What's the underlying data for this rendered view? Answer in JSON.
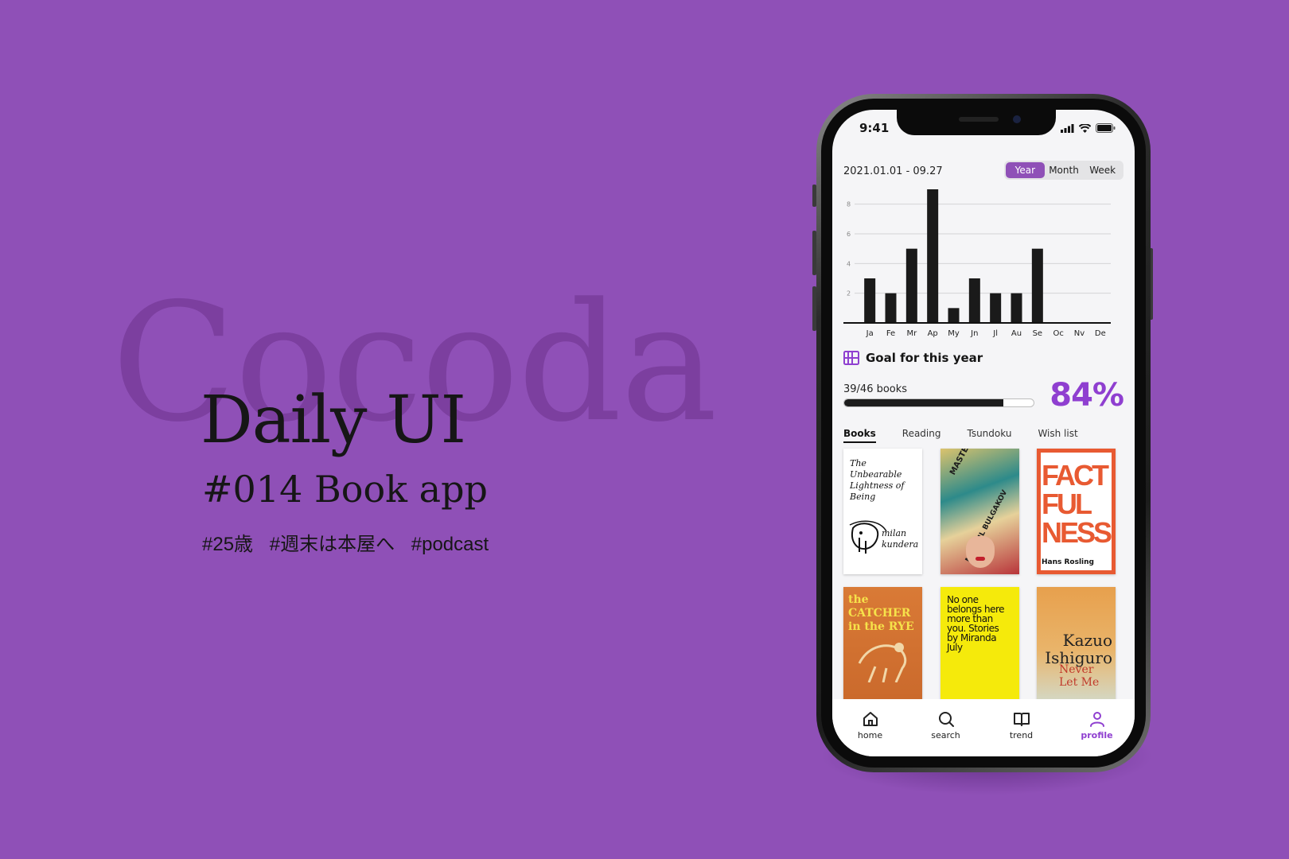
{
  "hero": {
    "watermark": "Cocoda",
    "title": "Daily UI",
    "subtitle": "#014 Book app",
    "tags": [
      "#25歳",
      "#週末は本屋へ",
      "#podcast"
    ]
  },
  "colors": {
    "background": "#8f50b7",
    "accent": "#8f3fd0"
  },
  "phone": {
    "status_time": "9:41",
    "status_icons": [
      "signal-icon",
      "wifi-icon",
      "battery-icon"
    ],
    "date_range": "2021.01.01 - 09.27",
    "period_options": [
      "Year",
      "Month",
      "Week"
    ],
    "period_selected": "Year",
    "goal": {
      "title": "Goal for this year",
      "count_label": "39/46 books",
      "percent_label": "84%",
      "progress": 0.84
    },
    "tabs": [
      "Books",
      "Reading",
      "Tsundoku",
      "Wish list"
    ],
    "active_tab": "Books",
    "books": [
      {
        "cover_text": "The Unbearable Lightness of Being",
        "author_text": "milan kundera"
      },
      {
        "cover_text": "MASTER & MARGARITA",
        "author_text": "MIKHAIL BULGAKOV"
      },
      {
        "cover_text": "FACT FUL NESS",
        "author_text": "Hans Rosling"
      },
      {
        "cover_text": "the CATCHER in the RYE",
        "author_text": ""
      },
      {
        "cover_text": "No one belongs here more than you. Stories by Miranda July",
        "author_text": ""
      },
      {
        "cover_text": "Never Let Me",
        "author_text": "Kazuo Ishiguro"
      }
    ],
    "nav": [
      {
        "label": "home",
        "icon": "home-icon"
      },
      {
        "label": "search",
        "icon": "search-icon"
      },
      {
        "label": "trend",
        "icon": "book-open-icon"
      },
      {
        "label": "profile",
        "icon": "user-icon"
      }
    ],
    "nav_active": "profile"
  },
  "chart_data": {
    "type": "bar",
    "categories": [
      "Ja",
      "Fe",
      "Mr",
      "Ap",
      "My",
      "Jn",
      "Jl",
      "Au",
      "Se",
      "Oc",
      "Nv",
      "De"
    ],
    "values": [
      3,
      2,
      5,
      9,
      1,
      3,
      2,
      2,
      5,
      0,
      0,
      0
    ],
    "yticks": [
      2,
      4,
      6,
      8
    ],
    "ylim": [
      0,
      9
    ],
    "grid": true,
    "title": "",
    "xlabel": "",
    "ylabel": ""
  }
}
